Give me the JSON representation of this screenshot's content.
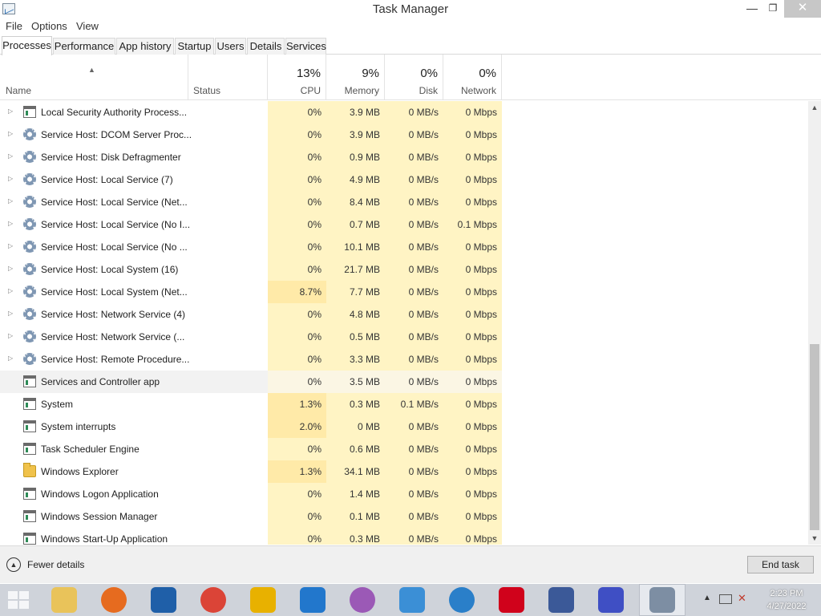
{
  "window": {
    "title": "Task Manager",
    "close_glyph": "✕",
    "minimize_glyph": "—",
    "restore_glyph": "❐",
    "icon": "task-manager-icon"
  },
  "menu": [
    "File",
    "Options",
    "View"
  ],
  "tabs": [
    "Processes",
    "Performance",
    "App history",
    "Startup",
    "Users",
    "Details",
    "Services"
  ],
  "active_tab": "Processes",
  "columns": {
    "name": "Name",
    "status": "Status",
    "cpu": {
      "pct": "13%",
      "label": "CPU"
    },
    "memory": {
      "pct": "9%",
      "label": "Memory"
    },
    "disk": {
      "pct": "0%",
      "label": "Disk"
    },
    "network": {
      "pct": "0%",
      "label": "Network"
    }
  },
  "processes": [
    {
      "name": "Local Security Authority Process...",
      "icon": "window-app-icon",
      "expandable": true,
      "cpu": "0%",
      "memory": "3.9 MB",
      "disk": "0 MB/s",
      "network": "0 Mbps"
    },
    {
      "name": "Service Host: DCOM Server Proc...",
      "icon": "service-gear-icon",
      "expandable": true,
      "cpu": "0%",
      "memory": "3.9 MB",
      "disk": "0 MB/s",
      "network": "0 Mbps"
    },
    {
      "name": "Service Host: Disk Defragmenter",
      "icon": "service-gear-icon",
      "expandable": true,
      "cpu": "0%",
      "memory": "0.9 MB",
      "disk": "0 MB/s",
      "network": "0 Mbps"
    },
    {
      "name": "Service Host: Local Service (7)",
      "icon": "service-gear-icon",
      "expandable": true,
      "cpu": "0%",
      "memory": "4.9 MB",
      "disk": "0 MB/s",
      "network": "0 Mbps"
    },
    {
      "name": "Service Host: Local Service (Net...",
      "icon": "service-gear-icon",
      "expandable": true,
      "cpu": "0%",
      "memory": "8.4 MB",
      "disk": "0 MB/s",
      "network": "0 Mbps"
    },
    {
      "name": "Service Host: Local Service (No I...",
      "icon": "service-gear-icon",
      "expandable": true,
      "cpu": "0%",
      "memory": "0.7 MB",
      "disk": "0 MB/s",
      "network": "0.1 Mbps"
    },
    {
      "name": "Service Host: Local Service (No ...",
      "icon": "service-gear-icon",
      "expandable": true,
      "cpu": "0%",
      "memory": "10.1 MB",
      "disk": "0 MB/s",
      "network": "0 Mbps"
    },
    {
      "name": "Service Host: Local System (16)",
      "icon": "service-gear-icon",
      "expandable": true,
      "cpu": "0%",
      "memory": "21.7 MB",
      "disk": "0 MB/s",
      "network": "0 Mbps"
    },
    {
      "name": "Service Host: Local System (Net...",
      "icon": "service-gear-icon",
      "expandable": true,
      "cpu": "8.7%",
      "memory": "7.7 MB",
      "disk": "0 MB/s",
      "network": "0 Mbps"
    },
    {
      "name": "Service Host: Network Service (4)",
      "icon": "service-gear-icon",
      "expandable": true,
      "cpu": "0%",
      "memory": "4.8 MB",
      "disk": "0 MB/s",
      "network": "0 Mbps"
    },
    {
      "name": "Service Host: Network Service (...",
      "icon": "service-gear-icon",
      "expandable": true,
      "cpu": "0%",
      "memory": "0.5 MB",
      "disk": "0 MB/s",
      "network": "0 Mbps"
    },
    {
      "name": "Service Host: Remote Procedure...",
      "icon": "service-gear-icon",
      "expandable": true,
      "cpu": "0%",
      "memory": "3.3 MB",
      "disk": "0 MB/s",
      "network": "0 Mbps"
    },
    {
      "name": "Services and Controller app",
      "icon": "window-app-icon",
      "expandable": false,
      "highlight": true,
      "cpu": "0%",
      "memory": "3.5 MB",
      "disk": "0 MB/s",
      "network": "0 Mbps"
    },
    {
      "name": "System",
      "icon": "window-app-icon",
      "expandable": false,
      "cpu": "1.3%",
      "memory": "0.3 MB",
      "disk": "0.1 MB/s",
      "network": "0 Mbps"
    },
    {
      "name": "System interrupts",
      "icon": "window-app-icon",
      "expandable": false,
      "cpu": "2.0%",
      "memory": "0 MB",
      "disk": "0 MB/s",
      "network": "0 Mbps"
    },
    {
      "name": "Task Scheduler Engine",
      "icon": "window-app-icon",
      "expandable": false,
      "cpu": "0%",
      "memory": "0.6 MB",
      "disk": "0 MB/s",
      "network": "0 Mbps"
    },
    {
      "name": "Windows Explorer",
      "icon": "folder-icon",
      "expandable": false,
      "cpu": "1.3%",
      "memory": "34.1 MB",
      "disk": "0 MB/s",
      "network": "0 Mbps"
    },
    {
      "name": "Windows Logon Application",
      "icon": "window-app-icon",
      "expandable": false,
      "cpu": "0%",
      "memory": "1.4 MB",
      "disk": "0 MB/s",
      "network": "0 Mbps"
    },
    {
      "name": "Windows Session Manager",
      "icon": "window-app-icon",
      "expandable": false,
      "cpu": "0%",
      "memory": "0.1 MB",
      "disk": "0 MB/s",
      "network": "0 Mbps"
    },
    {
      "name": "Windows Start-Up Application",
      "icon": "window-app-icon",
      "expandable": false,
      "cpu": "0%",
      "memory": "0.3 MB",
      "disk": "0 MB/s",
      "network": "0 Mbps"
    }
  ],
  "footer": {
    "fewer_details": "Fewer details",
    "end_task": "End task"
  },
  "colors": {
    "heat_low": "#fff4c4",
    "heat_mid": "#ffeaa8",
    "taskbar": "#cfd3da"
  },
  "taskbar": {
    "apps": [
      {
        "name": "file-explorer-icon",
        "color": "#e9c35a"
      },
      {
        "name": "firefox-icon",
        "color": "#e66b1f"
      },
      {
        "name": "arc-icon",
        "color": "#1f5fa8"
      },
      {
        "name": "chrome-icon",
        "color": "#db4437"
      },
      {
        "name": "keyhole-icon",
        "color": "#e8b100"
      },
      {
        "name": "maxthon-icon",
        "color": "#2277cc"
      },
      {
        "name": "colorful-pinwheel-icon",
        "color": "#9b59b6"
      },
      {
        "name": "refresh-c-icon",
        "color": "#3b8fd6"
      },
      {
        "name": "globe-icon",
        "color": "#2a7fc9"
      },
      {
        "name": "opera-icon",
        "color": "#d0021b"
      },
      {
        "name": "facebook-icon",
        "color": "#3b5998"
      },
      {
        "name": "settings-gear-icon",
        "color": "#3f4fc4"
      },
      {
        "name": "task-manager-taskbar-icon",
        "color": "#7d8ea3"
      }
    ],
    "clock_time": "2:23 PM",
    "clock_date": "4/27/2022"
  }
}
